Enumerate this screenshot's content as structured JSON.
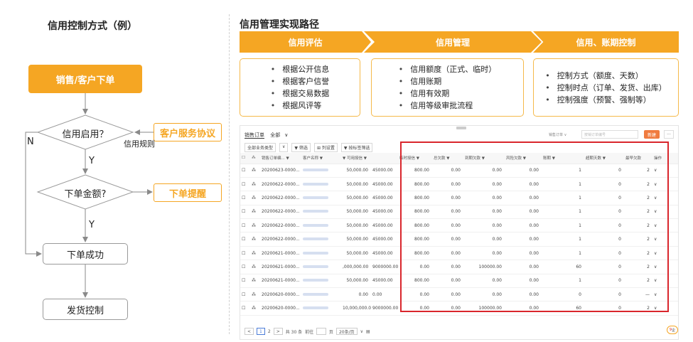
{
  "flow": {
    "title": "信用控制方式（例）",
    "start": "销售/客户下单",
    "decision1": "信用启用？",
    "decision2": "下单金额?",
    "ordered": "下单成功",
    "ship": "发货控制",
    "side_box1": "客户服务协议",
    "side_box2": "下单提醒",
    "label_no": "N",
    "label_yes1": "Y",
    "label_yes2": "Y",
    "label_rule": "信用规则"
  },
  "right": {
    "title": "信用管理实现路径",
    "stages": [
      {
        "name": "信用评估",
        "items": [
          "根据公开信息",
          "根据客户信誉",
          "根据交易数据",
          "根据风评等"
        ]
      },
      {
        "name": "信用管理",
        "items": [
          "信用额度（正式、临时）",
          "信用账期",
          "信用有效期",
          "信用等级审批流程"
        ]
      },
      {
        "name": "信用、账期控制",
        "items": [
          "控制方式（额度、天数）",
          "控制时点（订单、发货、出库）",
          "控制强度（预警、强制等）"
        ]
      }
    ]
  },
  "table": {
    "tab": "销售订单",
    "all": "全部",
    "filters": [
      "全部业务类型",
      "",
      "筛选",
      "列设置",
      "按标签筛选"
    ],
    "type_select": "销售订单 ∨",
    "search_placeholder": "按销订单编号",
    "new_btn": "新建",
    "more_btn": "···",
    "headers": [
      "",
      "",
      "销售订单编... ▼",
      "客户名称 ▼",
      "▼ 可用授信 ▼",
      "",
      "临时授信 ▼",
      "总欠款 ▼",
      "到期欠款 ▼",
      "风险欠款 ▼",
      "账期 ▼",
      "超期天数 ▼",
      "最早欠款",
      "操作"
    ],
    "rows": [
      [
        "20200623-0000...",
        "50,000.00",
        "45000.00",
        "800.00",
        "0.00",
        "0.00",
        "0.00",
        "1",
        "0",
        "2"
      ],
      [
        "20200622-0000...",
        "50,000.00",
        "45000.00",
        "800.00",
        "0.00",
        "0.00",
        "0.00",
        "1",
        "0",
        "2"
      ],
      [
        "20200622-0000...",
        "50,000.00",
        "45000.00",
        "800.00",
        "0.00",
        "0.00",
        "0.00",
        "1",
        "0",
        "2"
      ],
      [
        "20200622-0000...",
        "50,000.00",
        "45000.00",
        "800.00",
        "0.00",
        "0.00",
        "0.00",
        "1",
        "0",
        "2"
      ],
      [
        "20200622-0000...",
        "50,000.00",
        "45000.00",
        "800.00",
        "0.00",
        "0.00",
        "0.00",
        "1",
        "0",
        "2"
      ],
      [
        "20200622-0000...",
        "50,000.00",
        "45000.00",
        "800.00",
        "0.00",
        "0.00",
        "0.00",
        "1",
        "0",
        "2"
      ],
      [
        "20200621-0000...",
        "50,000.00",
        "45000.00",
        "800.00",
        "0.00",
        "0.00",
        "0.00",
        "1",
        "0",
        "2"
      ],
      [
        "20200621-0000...",
        ",000,000.00",
        "9000000.00",
        "0.00",
        "0.00",
        "100000.00",
        "0.00",
        "60",
        "0",
        "2"
      ],
      [
        "20200621-0000...",
        "50,000.00",
        "45000.00",
        "800.00",
        "0.00",
        "0.00",
        "0.00",
        "1",
        "0",
        "2"
      ],
      [
        "20200620-0000...",
        "0.00",
        "0.00",
        "0.00",
        "0.00",
        "0.00",
        "0.00",
        "0",
        "0",
        "—"
      ],
      [
        "20200620-0000...",
        "10,000,000.00",
        "9000000.00",
        "0.00",
        "0.00",
        "100000.00",
        "0.00",
        "60",
        "0",
        "2"
      ]
    ],
    "footer": {
      "prev": "<",
      "page1": "1",
      "page2": "2",
      "next": ">",
      "total": "共 30 条",
      "goto": "前往",
      "page_unit": "页",
      "per_page": "20条/页"
    },
    "badge": "9",
    "badge_text": "企"
  },
  "colors": {
    "accent": "#f5a623",
    "highlight": "#d9262c"
  }
}
